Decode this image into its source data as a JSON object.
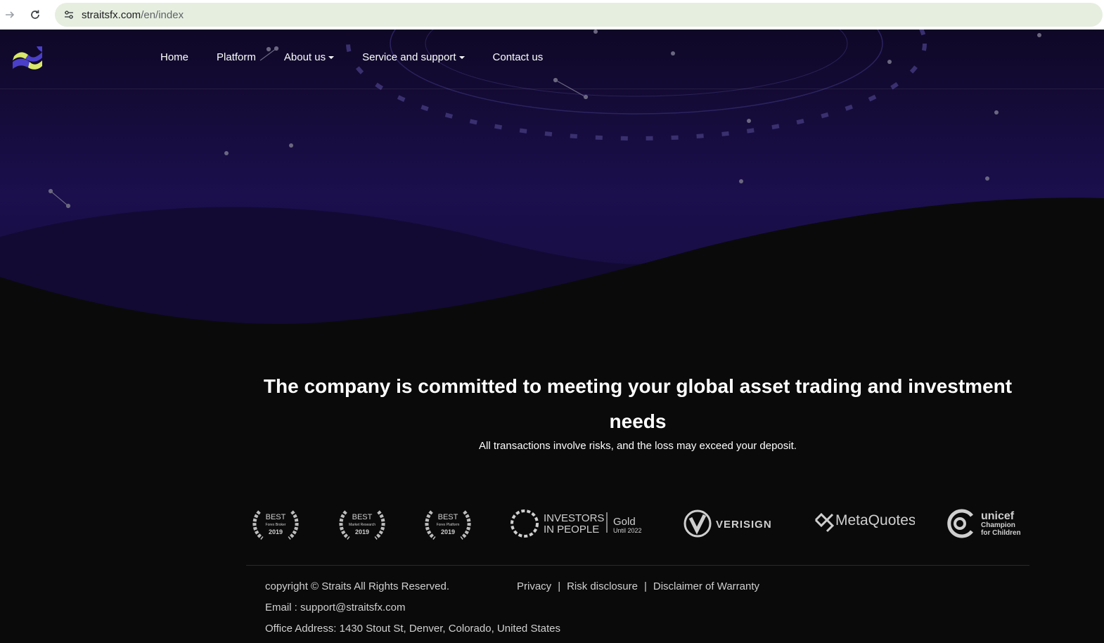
{
  "browser": {
    "url_host": "straitsfx.com",
    "url_path": "/en/index"
  },
  "nav": {
    "items": [
      {
        "label": "Home",
        "dropdown": false
      },
      {
        "label": "Platform",
        "dropdown": false
      },
      {
        "label": "About us",
        "dropdown": true
      },
      {
        "label": "Service and support",
        "dropdown": true
      },
      {
        "label": "Contact us",
        "dropdown": false
      }
    ]
  },
  "hero": {
    "headline": "The company is committed to meeting your global asset trading and investment needs",
    "risk_note": "All transactions involve risks, and the loss may exceed your deposit."
  },
  "badges": {
    "award1": {
      "top": "BEST",
      "mid": "Forex Broker",
      "year": "2019"
    },
    "award2": {
      "top": "BEST",
      "mid": "Market Research",
      "year": "2019"
    },
    "award3": {
      "top": "BEST",
      "mid": "Forex Platform",
      "year": "2019"
    },
    "iip": {
      "line1": "INVESTORS",
      "line2": "IN PEOPLE",
      "level": "Gold",
      "until": "Until 2022"
    },
    "verisign": {
      "name": "VERISIGN"
    },
    "metaquotes": {
      "name": "MetaQuotes"
    },
    "unicef": {
      "name": "unicef",
      "line1": "Champion",
      "line2": "for Children"
    }
  },
  "footer": {
    "copyright": "copyright © Straits All Rights Reserved.",
    "email": "Email : support@straitsfx.com",
    "address": "Office Address: 1430 Stout St, Denver, Colorado, United States",
    "links": [
      "Privacy",
      "Risk disclosure",
      "Disclaimer of Warranty"
    ],
    "separator": "|"
  },
  "colors": {
    "hero_top": "#120a2e",
    "hero_mid": "#1b0f4a",
    "page_bg": "#0a0a0a",
    "logo_yellow": "#d9e86a",
    "logo_indigo": "#4a3fc8"
  },
  "icons": {
    "back": "arrow-right-icon",
    "reload": "reload-icon",
    "site_info": "tune-icon",
    "caret": "caret-down-icon"
  }
}
